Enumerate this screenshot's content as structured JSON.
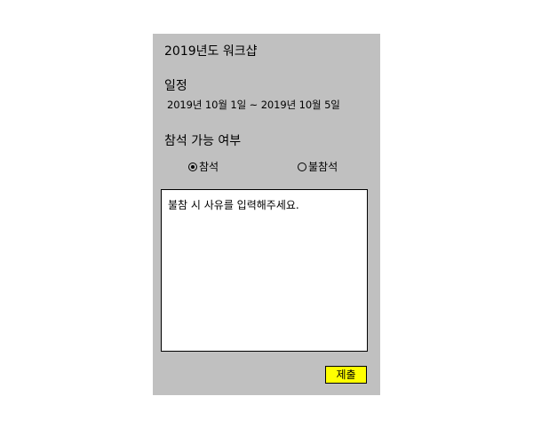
{
  "form": {
    "title": "2019년도 워크샵",
    "schedule_label": "일정",
    "schedule_value": "2019년 10월 1일 ~ 2019년 10월 5일",
    "attendance_label": "참석 가능 여부",
    "options": [
      {
        "label": "참석",
        "selected": true
      },
      {
        "label": "불참석",
        "selected": false
      }
    ],
    "reason_placeholder": "불참 시 사유를 입력해주세요.",
    "submit_label": "제출"
  },
  "colors": {
    "panel_background": "#c0c0c0",
    "submit_background": "#ffff00",
    "textarea_background": "#ffffff"
  }
}
